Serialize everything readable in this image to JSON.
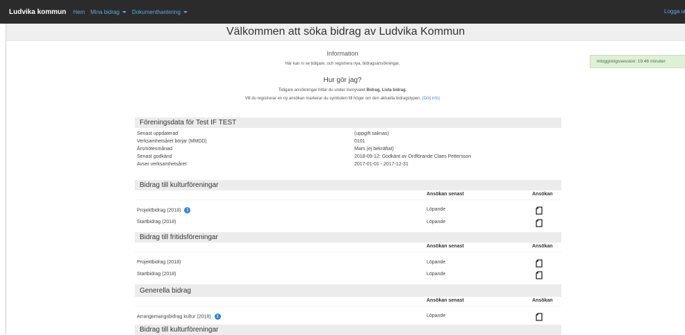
{
  "nav": {
    "brand": "Ludvika kommun",
    "links": [
      "Hem",
      "Mina bidrag",
      "Dokumenthantering"
    ],
    "logout": "Logga ut"
  },
  "page": {
    "title": "Välkommen att söka bidrag av Ludvika Kommun",
    "info_title": "Information",
    "info_text": "Här kan ni se tidigare, och registrera nya, bidragsansökningar.",
    "how_title": "Hur gör jag?",
    "how_text1_pre": "Tidigare ansökningar hittar du under menyvalet ",
    "how_text1_bold": "Bidrag, Lista bidrag",
    "how_text1_post": ".",
    "how_text2": "Vill du registrerar en ny ansökan markerar du symbolen till höger om den aktuella bidragstypen.",
    "how_text2_link": "(Dölj info)"
  },
  "session": {
    "text": "Inloggningssession: 19:46 minuter"
  },
  "forening": {
    "header": "Föreningsdata för Test IF TEST",
    "rows": [
      {
        "label": "Senast uppdaterad",
        "value": "(uppgift saknas)"
      },
      {
        "label": "Verksamhetsåret börjar (MMDD)",
        "value": "0101"
      },
      {
        "label": "Årsmötesmånad",
        "value": "Mars (ej bekräftat)"
      },
      {
        "label": "Senast godkänd",
        "value": "2018-09-12: Godkänt av Ordförande Claes Pettersson"
      },
      {
        "label": "Avser verksamhetsåret",
        "value": "2017-01-01 - 2017-12-31"
      }
    ]
  },
  "columns": {
    "senast": "Ansökan senast",
    "ansokan": "Ansökan"
  },
  "sections": [
    {
      "header": "Bidrag till kulturföreningar",
      "rows": [
        {
          "name": "Projektbidrag (2018)",
          "info": true,
          "senast": "Löpande"
        },
        {
          "name": "Startbidrag (2018)",
          "info": false,
          "senast": "Löpande"
        }
      ]
    },
    {
      "header": "Bidrag till fritidsföreningar",
      "rows": [
        {
          "name": "Projektbidrag (2018)",
          "info": false,
          "senast": "Löpande"
        },
        {
          "name": "Startbidrag (2018)",
          "info": false,
          "senast": "Löpande"
        }
      ]
    },
    {
      "header": "Generella bidrag",
      "rows": [
        {
          "name": "Arrangemangsbidrag kultur (2018)",
          "info": true,
          "senast": "Löpande"
        }
      ]
    },
    {
      "header": "Bidrag till kulturföreningar",
      "rows": []
    }
  ]
}
